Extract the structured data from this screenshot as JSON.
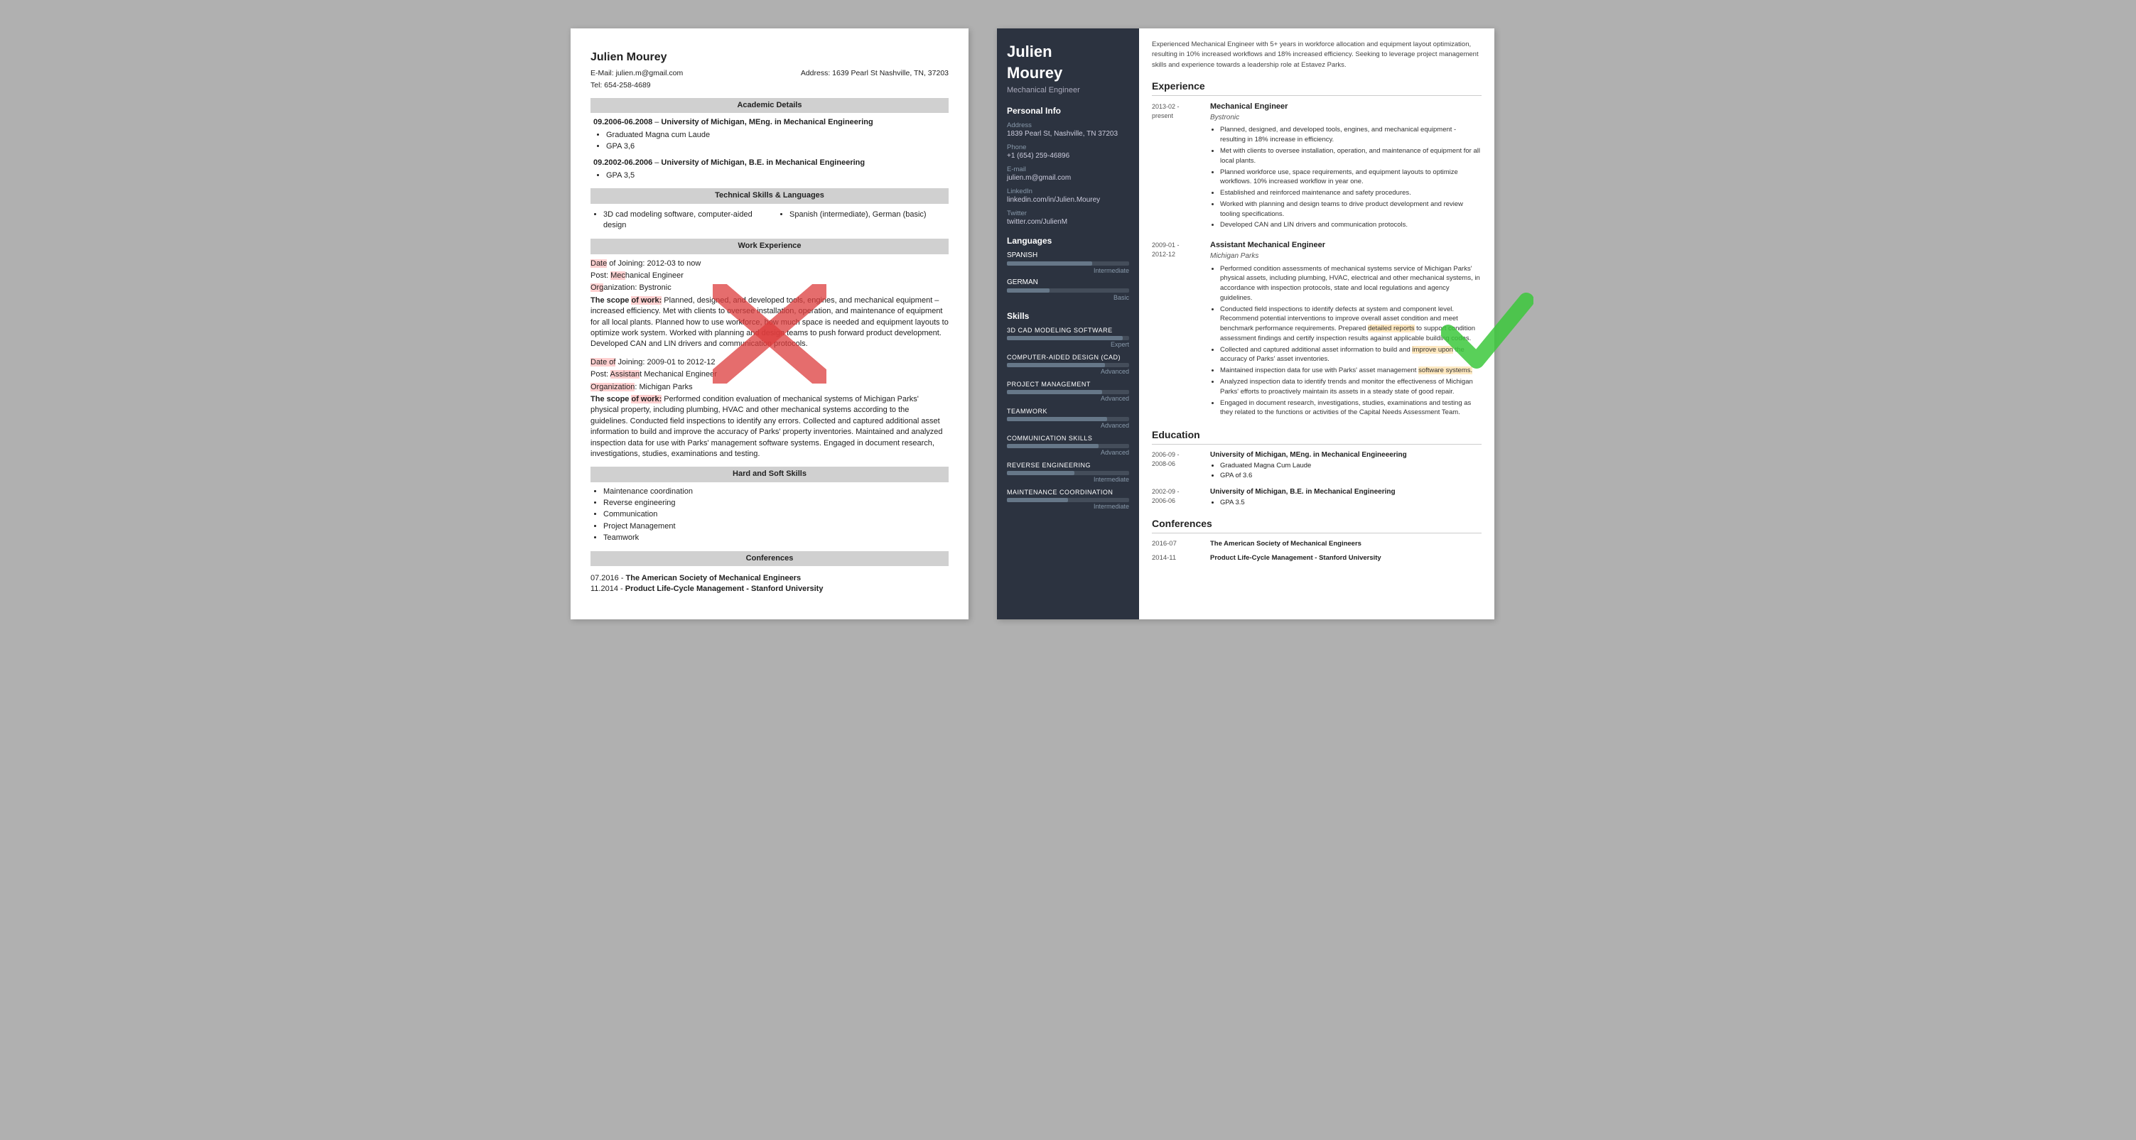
{
  "leftResume": {
    "name": "Julien Mourey",
    "email": "E-Mail: julien.m@gmail.com",
    "address": "Address: 1639 Pearl St Nashville, TN, 37203",
    "tel": "Tel: 654-258-4689",
    "sections": {
      "academic": "Academic Details",
      "technicalSkills": "Technical Skills & Languages",
      "workExperience": "Work Experience",
      "hardSoftSkills": "Hard and Soft Skills",
      "conferences": "Conferences"
    },
    "education": [
      {
        "dates": "09.2006-06.2008",
        "degree": "University of Michigan, MEng. in Mechanical Engineering",
        "details": [
          "Graduated Magna cum Laude",
          "GPA 3,6"
        ]
      },
      {
        "dates": "09.2002-06.2006",
        "degree": "University of Michigan, B.E. in Mechanical Engineering",
        "details": [
          "GPA 3,5"
        ]
      }
    ],
    "skills": [
      "3D cad modeling software, computer-aided design",
      "Spanish (intermediate), German (basic)"
    ],
    "workExp": [
      {
        "dateJoining": "Date of Joining: 2012-03 to now",
        "post": "Post: Mechanical Engineer",
        "org": "Organization: Bystronic",
        "scope": "The scope of work: Planned, designed, and developed tools, engines, and mechanical equipment – increased efficiency. Met with clients to oversee installation, operation, and maintenance of equipment for all local plants. Planned how to use workforce, how much space is needed and equipment layouts to optimize work system. Worked with planning and design teams to push forward product development. Developed CAN and LIN drivers and communication protocols."
      },
      {
        "dateJoining": "Date of Joining: 2009-01 to 2012-12",
        "post": "Post: Assistant Mechanical Engineer",
        "org": "Organization: Michigan Parks",
        "scope": "The scope of work: Performed condition evaluation of mechanical systems of Michigan Parks' physical property, including plumbing, HVAC and other mechanical systems according to the guidelines. Conducted field inspections to identify any errors. Collected and captured additional asset information to build and improve the accuracy of Parks' property inventories. Maintained and analyzed inspection data for use with Parks' management software systems. Engaged in document research, investigations, studies, examinations and testing."
      }
    ],
    "hardSkills": [
      "Maintenance coordination",
      "Reverse engineering",
      "Communication",
      "Project Management",
      "Teamwork"
    ],
    "conferencesSection": [
      {
        "date": "07.2016 -",
        "name": "The American Society of Mechanical Engineers"
      },
      {
        "date": "11.2014 -",
        "name": "Product Life-Cycle Management - Stanford University"
      }
    ]
  },
  "rightResume": {
    "name": "Julien",
    "surname": "Mourey",
    "title": "Mechanical Engineer",
    "summary": "Experienced Mechanical Engineer with 5+ years in workforce allocation and equipment layout optimization, resulting in 10% increased workflows and 18% increased efficiency. Seeking to leverage project management skills and experience towards a leadership role at Estavez Parks.",
    "personalInfo": {
      "sectionTitle": "Personal Info",
      "address": {
        "label": "Address",
        "value": "1839 Pearl St, Nashville, TN 37203"
      },
      "phone": {
        "label": "Phone",
        "value": "+1 (654) 259-46896"
      },
      "email": {
        "label": "E-mail",
        "value": "julien.m@gmail.com"
      },
      "linkedin": {
        "label": "LinkedIn",
        "value": "linkedin.com/in/Julien.Mourey"
      },
      "twitter": {
        "label": "Twitter",
        "value": "twitter.com/JulienM"
      }
    },
    "languages": {
      "sectionTitle": "Languages",
      "items": [
        {
          "name": "SPANISH",
          "percent": 70,
          "level": "Intermediate"
        },
        {
          "name": "GERMAN",
          "percent": 35,
          "level": "Basic"
        }
      ]
    },
    "skills": {
      "sectionTitle": "Skills",
      "items": [
        {
          "name": "3D CAD MODELING SOFTWARE",
          "percent": 95,
          "level": "Expert"
        },
        {
          "name": "COMPUTER-AIDED DESIGN (CAD)",
          "percent": 80,
          "level": "Advanced"
        },
        {
          "name": "PROJECT MANAGEMENT",
          "percent": 78,
          "level": "Advanced"
        },
        {
          "name": "TEAMWORK",
          "percent": 82,
          "level": "Advanced"
        },
        {
          "name": "COMMUNICATION SKILLS",
          "percent": 75,
          "level": "Advanced"
        },
        {
          "name": "REVERSE ENGINEERING",
          "percent": 55,
          "level": "Intermediate"
        },
        {
          "name": "MAINTENANCE COORDINATION",
          "percent": 50,
          "level": "Intermediate"
        }
      ]
    },
    "experience": {
      "sectionTitle": "Experience",
      "items": [
        {
          "dates": "2013-02 -\npresent",
          "title": "Mechanical Engineer",
          "company": "Bystronic",
          "bullets": [
            "Planned, designed, and developed tools, engines, and mechanical equipment - resulting in 18% increase in efficiency.",
            "Met with clients to oversee installation, operation, and maintenance of equipment for all local plants.",
            "Planned workforce use, space requirements, and equipment layouts to optimize workflows. 10% increased workflow in year one.",
            "Established and reinforced maintenance and safety procedures.",
            "Worked with planning and design teams to drive product development and review tooling specifications.",
            "Developed CAN and LIN drivers and communication protocols."
          ]
        },
        {
          "dates": "2009-01 -\n2012-12",
          "title": "Assistant Mechanical Engineer",
          "company": "Michigan Parks",
          "bullets": [
            "Performed condition assessments of mechanical systems service of Michigan Parks' physical assets, including plumbing, HVAC, electrical and other mechanical systems, in accordance with inspection protocols, state and local regulations and agency guidelines.",
            "Conducted field inspections to identify defects at system and component level. Recommend potential interventions to improve overall asset condition and meet benchmark performance requirements. Prepared detailed reports to support condition assessment findings and certify inspection results against applicable building codes.",
            "Collected and captured additional asset information to build and improve upon the accuracy of Parks' asset inventories.",
            "Maintained inspection data for use with Parks' asset management software systems.",
            "Analyzed inspection data to identify trends and monitor the effectiveness of Michigan Parks' efforts to proactively maintain its assets in a steady state of good repair.",
            "Engaged in document research, investigations, studies, examinations and testing as they related to the functions or activities of the Capital Needs Assessment Team."
          ]
        }
      ]
    },
    "education": {
      "sectionTitle": "Education",
      "items": [
        {
          "dates": "2006-09 -\n2008-06",
          "degree": "University of Michigan, MEng. in Mechanical Engineeering",
          "bullets": [
            "Graduated Magna Cum Laude",
            "GPA of 3.6"
          ]
        },
        {
          "dates": "2002-09 -\n2006-06",
          "degree": "University of Michigan, B.E. in Mechanical Engineering",
          "bullets": [
            "GPA 3.5"
          ]
        }
      ]
    },
    "conferences": {
      "sectionTitle": "Conferences",
      "items": [
        {
          "date": "2016-07",
          "name": "The American Society of Mechanical Engineers"
        },
        {
          "date": "2014-11",
          "name": "Product Life-Cycle Management - Stanford University"
        }
      ]
    }
  }
}
